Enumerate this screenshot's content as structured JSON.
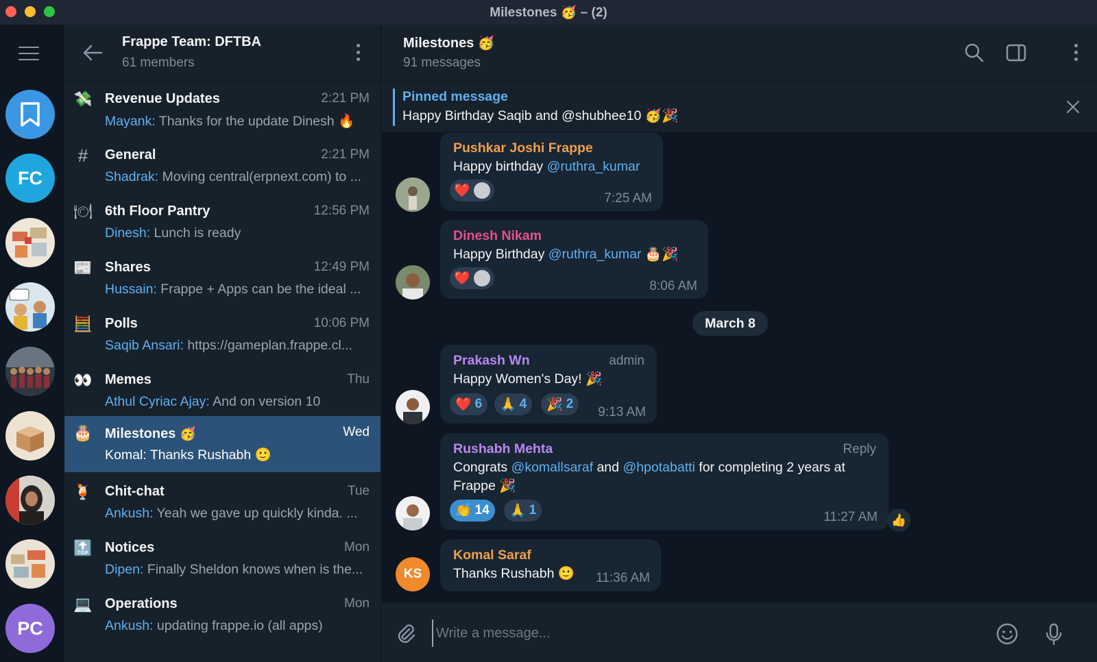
{
  "window": {
    "title": "Milestones 🥳 – (2)"
  },
  "rail": {
    "items": [
      {
        "label": "",
        "name": "saved-messages",
        "color": "#3a97e3"
      },
      {
        "label": "FC",
        "name": "fc",
        "color": "#1fa6df"
      },
      {
        "label": "",
        "name": "office-map",
        "color": "#e9e1d6"
      },
      {
        "label": "",
        "name": "cartoon",
        "color": "#d9e6ef"
      },
      {
        "label": "",
        "name": "team-photo",
        "color": "#3b4a58"
      },
      {
        "label": "",
        "name": "boxes",
        "color": "#e8d2b6"
      },
      {
        "label": "",
        "name": "person-photo",
        "color": "#c94c3e"
      },
      {
        "label": "",
        "name": "office-map-2",
        "color": "#e5ddd2"
      },
      {
        "label": "PC",
        "name": "pc",
        "color": "#8f6bd9"
      }
    ]
  },
  "group": {
    "title": "Frappe Team: DFTBA",
    "subtitle": "61 members"
  },
  "chats": [
    {
      "name": "Revenue Updates",
      "icon": "💸",
      "time": "2:21 PM",
      "sender": "Mayank:",
      "preview": "Thanks for the update Dinesh 🔥",
      "active": false
    },
    {
      "name": "General",
      "icon": "#",
      "time": "2:21 PM",
      "sender": "Shadrak:",
      "preview": "Moving central(erpnext.com) to ...",
      "active": false
    },
    {
      "name": "6th Floor Pantry",
      "icon": "🍽",
      "time": "12:56 PM",
      "sender": "Dinesh:",
      "preview": "Lunch is ready",
      "active": false
    },
    {
      "name": "Shares",
      "icon": "📰",
      "time": "12:49 PM",
      "sender": "Hussain:",
      "preview": "Frappe + Apps can be the ideal ...",
      "active": false
    },
    {
      "name": "Polls",
      "icon": "🧮",
      "time": "10:06 PM",
      "sender": "Saqib Ansari:",
      "preview": "https://gameplan.frappe.cl...",
      "active": false
    },
    {
      "name": "Memes",
      "icon": "👀",
      "time": "Thu",
      "sender": "Athul Cyriac Ajay:",
      "preview": "And on version 10",
      "active": false
    },
    {
      "name": "Milestones 🥳",
      "icon": "🎂",
      "time": "Wed",
      "sender": "Komal:",
      "preview": "Thanks Rushabh 🙂",
      "active": true
    },
    {
      "name": "Chit-chat",
      "icon": "🍹",
      "time": "Tue",
      "sender": "Ankush:",
      "preview": "Yeah we gave up quickly kinda. ...",
      "active": false
    },
    {
      "name": "Notices",
      "icon": "🔝",
      "time": "Mon",
      "sender": "Dipen:",
      "preview": "Finally Sheldon knows when is the...",
      "active": false
    },
    {
      "name": "Operations",
      "icon": "💻",
      "time": "Mon",
      "sender": "Ankush:",
      "preview": "updating frappe.io (all apps)",
      "active": false
    }
  ],
  "chat": {
    "title": "Milestones 🥳",
    "subtitle": "91 messages",
    "pinned": {
      "label": "Pinned message",
      "text": "Happy Birthday Saqib and @shubhee10 🥳🎉"
    },
    "date_separator": "March 8",
    "messages": [
      {
        "author": "Pushkar Joshi Frappe",
        "author_color": "#f0a04b",
        "text_pre": "Happy birthday ",
        "mention": "@ruthra_kumar",
        "text_post": "",
        "time": "7:25 AM",
        "reaction": "❤️"
      },
      {
        "author": "Dinesh Nikam",
        "author_color": "#e6508b",
        "text_pre": "Happy Birthday ",
        "mention": "@ruthra_kumar",
        "text_post": " 🎂🎉",
        "time": "8:06 AM",
        "reaction": "❤️"
      },
      {
        "author": "Prakash Wn",
        "author_color": "#b988f0",
        "role": "admin",
        "text": "Happy Women's Day! 🎉",
        "time": "9:13 AM",
        "reactions": [
          {
            "emoji": "❤️",
            "count": "6"
          },
          {
            "emoji": "🙏",
            "count": "4"
          },
          {
            "emoji": "🎉",
            "count": "2"
          }
        ]
      },
      {
        "author": "Rushabh Mehta",
        "author_color": "#b988f0",
        "role": "Reply",
        "text_a": "Congrats ",
        "mention_a": "@komallsaraf",
        "text_b": " and ",
        "mention_b": "@hpotabatti",
        "text_c": " for completing 2 years at",
        "text_d": "Frappe 🎉",
        "time": "11:27 AM",
        "reactions": [
          {
            "emoji": "👏",
            "count": "14"
          },
          {
            "emoji": "🙏",
            "count": "1"
          }
        ],
        "side_reaction": "👍"
      },
      {
        "author": "Komal Saraf",
        "author_color": "#f0a04b",
        "avatar_initials": "KS",
        "text": "Thanks Rushabh 🙂",
        "time": "11:36 AM"
      }
    ]
  },
  "compose": {
    "placeholder": "Write a message..."
  }
}
